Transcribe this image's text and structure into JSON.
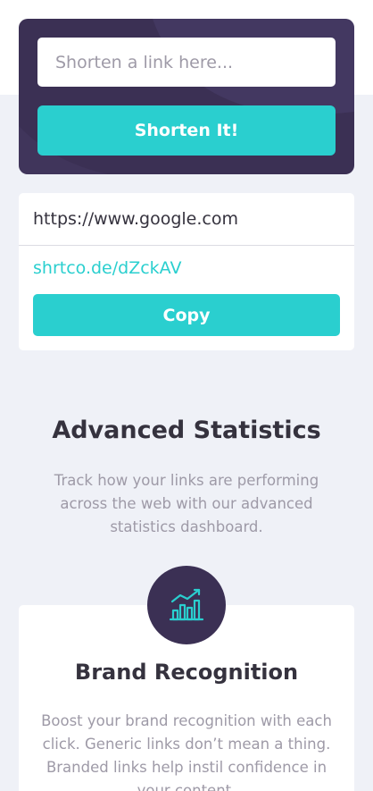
{
  "colors": {
    "primary": "#2acfcf",
    "dark_violet": "#3b3054",
    "very_dark": "#35323e",
    "gray": "#9e9aa7",
    "background": "#eff1f7"
  },
  "shorten": {
    "placeholder": "Shorten a link here...",
    "button_label": "Shorten It!"
  },
  "result": {
    "original_url": "https://www.google.com",
    "short_url": "shrtco.de/dZckAV",
    "copy_label": "Copy"
  },
  "statistics": {
    "title": "Advanced Statistics",
    "description": "Track how your links are performing across the web with our advanced statistics dashboard."
  },
  "feature": {
    "icon": "chart-icon",
    "title": "Brand Recognition",
    "description": "Boost your brand recognition with each click. Generic links don’t mean a thing. Branded links help instil confidence in your content."
  }
}
